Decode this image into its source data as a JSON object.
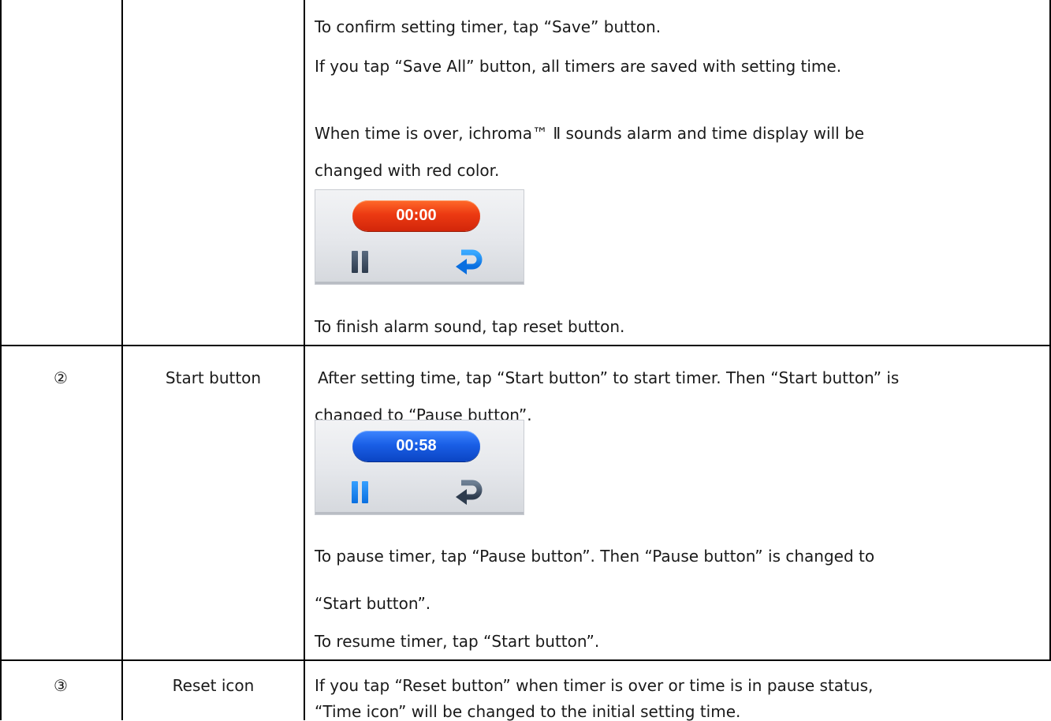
{
  "table": {
    "rows": [
      {
        "number": "",
        "name": "",
        "lines": [
          "To confirm setting timer, tap “Save” button.",
          "If you tap “Save All” button, all timers are saved with setting time.",
          "When time is over, ichroma™  Ⅱ sounds alarm and time display will be",
          "changed with red color.",
          "To finish alarm sound, tap reset button."
        ],
        "widget": {
          "time": "00:00",
          "pill_color": "#e8400f",
          "pause_icon": "pause-icon",
          "reset_icon": "reset-arrow-icon"
        }
      },
      {
        "number": "②",
        "name": "Start button",
        "lines": [
          "After setting time, tap “Start button” to start timer. Then “Start button” is",
          "changed to “Pause button”.",
          "To pause timer, tap “Pause button”. Then “Pause button” is changed to",
          "“Start button”.",
          "To resume timer, tap “Start button”."
        ],
        "widget": {
          "time": "00:58",
          "pill_color": "#1a5fe6",
          "pause_icon": "pause-icon",
          "reset_icon": "reset-arrow-icon"
        }
      },
      {
        "number": "③",
        "name": "Reset icon",
        "lines": [
          "If you tap “Reset button” when timer is over or time is in pause status,",
          "“Time icon” will be changed to the initial setting time."
        ]
      }
    ]
  }
}
